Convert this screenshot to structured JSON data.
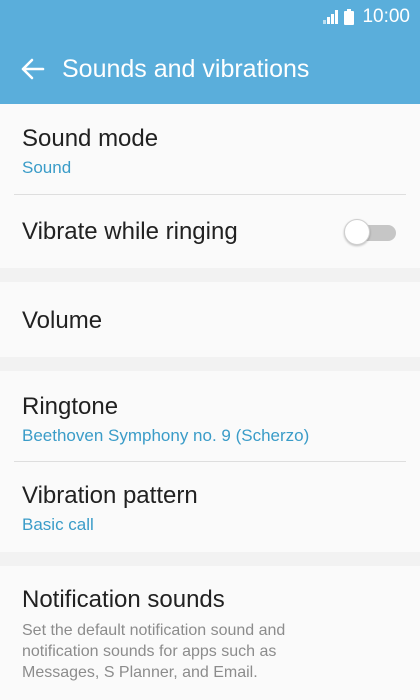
{
  "status_bar": {
    "time": "10:00",
    "signal_icon": "signal-icon",
    "battery_icon": "battery-icon"
  },
  "app_bar": {
    "title": "Sounds and vibrations",
    "back_icon": "back-arrow-icon"
  },
  "settings": {
    "sound_mode": {
      "title": "Sound mode",
      "value": "Sound"
    },
    "vibrate_while_ringing": {
      "title": "Vibrate while ringing",
      "enabled": false
    },
    "volume": {
      "title": "Volume"
    },
    "ringtone": {
      "title": "Ringtone",
      "value": "Beethoven Symphony no. 9 (Scherzo)"
    },
    "vibration_pattern": {
      "title": "Vibration pattern",
      "value": "Basic call"
    },
    "notification_sounds": {
      "title": "Notification sounds",
      "description": "Set the default notification sound and notification sounds for apps such as Messages, S Planner, and Email."
    }
  },
  "colors": {
    "accent": "#5aaedb",
    "link": "#3a9cc8",
    "background": "#f2f2f2"
  }
}
